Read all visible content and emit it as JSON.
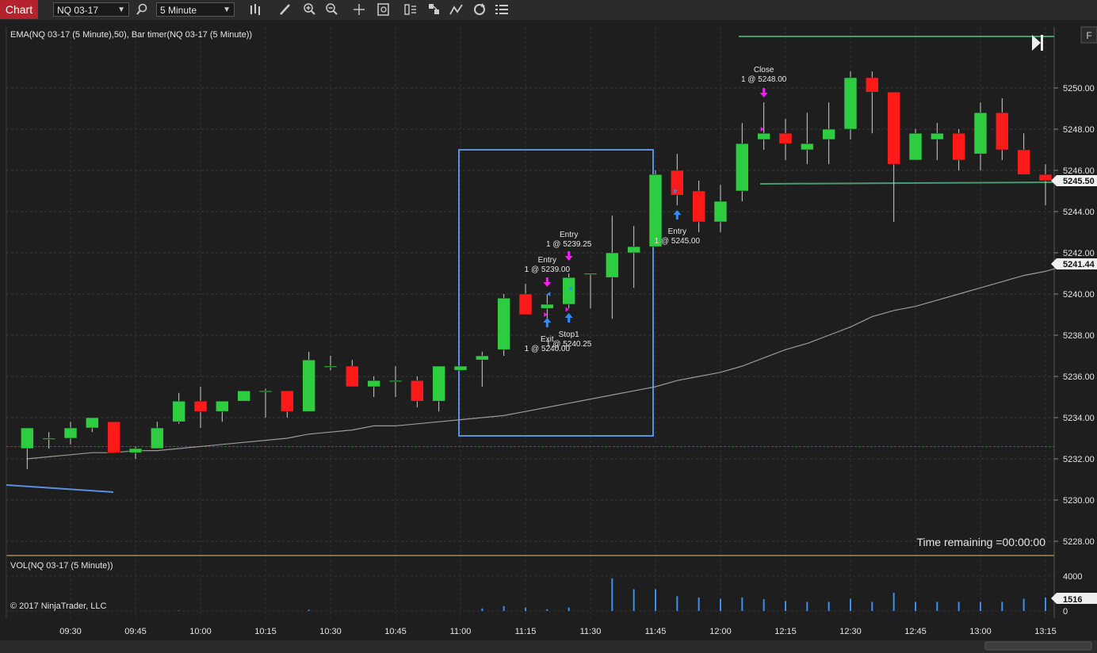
{
  "toolbar": {
    "chart_tab_label": "Chart",
    "instrument": "NQ 03-17",
    "interval": "5 Minute",
    "icons": [
      "search-icon",
      "bar-type-icon",
      "draw-pencil-icon",
      "zoom-in-icon",
      "zoom-out-icon",
      "crosshair-icon",
      "data-box-icon",
      "chart-trader-icon",
      "strategies-icon",
      "indicators-icon",
      "reload-icon",
      "properties-icon"
    ]
  },
  "price_panel": {
    "indicator_label": "EMA(NQ 03-17 (5 Minute),50), Bar timer(NQ 03-17 (5 Minute))",
    "time_remaining": "Time remaining =00:00:00",
    "panel_button": "F",
    "current_price_label": "5245.50",
    "ema_price_label": "5241.44",
    "colors": {
      "up": "#2ecc40",
      "down": "#ff1a1a",
      "ema": "#9a9a9a",
      "drawing_box": "#5b8fe0",
      "horizontal_lines": "#4a9b6e",
      "dashed_line": "#c0252d"
    }
  },
  "volume_panel": {
    "label": "VOL(NQ 03-17 (5 Minute))",
    "copyright": "© 2017 NinjaTrader, LLC",
    "current_volume_label": "1516",
    "color": "#3d8ff0"
  },
  "chart_data": {
    "type": "candlestick",
    "instrument": "NQ 03-17",
    "interval": "5 Minute",
    "price_axis_ticks": [
      "5250.00",
      "5248.00",
      "5246.00",
      "5244.00",
      "5242.00",
      "5240.00",
      "5238.00",
      "5236.00",
      "5234.00",
      "5232.00",
      "5230.00",
      "5228.00"
    ],
    "ylim": [
      5227.5,
      5251.6
    ],
    "volume_axis_ticks": [
      "4000",
      "0"
    ],
    "time_axis_ticks": [
      "09:30",
      "09:45",
      "10:00",
      "10:15",
      "10:30",
      "10:45",
      "11:00",
      "11:15",
      "11:30",
      "11:45",
      "12:00",
      "12:15",
      "12:30",
      "12:45",
      "13:00",
      "13:15"
    ],
    "bars": [
      {
        "time": "09:20",
        "o": 5232.5,
        "h": 5233.0,
        "l": 5231.5,
        "c": 5233.5
      },
      {
        "time": "09:25",
        "o": 5233.0,
        "h": 5233.3,
        "l": 5232.5,
        "c": 5233.0
      },
      {
        "time": "09:30",
        "o": 5233.0,
        "h": 5233.8,
        "l": 5232.7,
        "c": 5233.5
      },
      {
        "time": "09:35",
        "o": 5233.5,
        "h": 5234.0,
        "l": 5233.3,
        "c": 5234.0
      },
      {
        "time": "09:40",
        "o": 5233.8,
        "h": 5233.8,
        "l": 5232.3,
        "c": 5232.3
      },
      {
        "time": "09:45",
        "o": 5232.3,
        "h": 5232.6,
        "l": 5232.0,
        "c": 5232.5
      },
      {
        "time": "09:50",
        "o": 5232.5,
        "h": 5233.8,
        "l": 5232.5,
        "c": 5233.5
      },
      {
        "time": "09:55",
        "o": 5233.8,
        "h": 5235.2,
        "l": 5233.7,
        "c": 5234.8
      },
      {
        "time": "10:00",
        "o": 5234.8,
        "h": 5235.5,
        "l": 5233.5,
        "c": 5234.3
      },
      {
        "time": "10:05",
        "o": 5234.3,
        "h": 5234.8,
        "l": 5233.8,
        "c": 5234.8
      },
      {
        "time": "10:10",
        "o": 5234.8,
        "h": 5235.3,
        "l": 5234.8,
        "c": 5235.3
      },
      {
        "time": "10:15",
        "o": 5235.3,
        "h": 5235.4,
        "l": 5234.0,
        "c": 5235.3
      },
      {
        "time": "10:20",
        "o": 5235.3,
        "h": 5235.3,
        "l": 5234.0,
        "c": 5234.3
      },
      {
        "time": "10:25",
        "o": 5234.3,
        "h": 5237.2,
        "l": 5234.3,
        "c": 5236.8
      },
      {
        "time": "10:30",
        "o": 5236.5,
        "h": 5237.0,
        "l": 5236.3,
        "c": 5236.5
      },
      {
        "time": "10:35",
        "o": 5236.5,
        "h": 5236.8,
        "l": 5235.5,
        "c": 5235.5
      },
      {
        "time": "10:40",
        "o": 5235.5,
        "h": 5236.0,
        "l": 5235.0,
        "c": 5235.8
      },
      {
        "time": "10:45",
        "o": 5235.8,
        "h": 5236.5,
        "l": 5235.0,
        "c": 5235.8
      },
      {
        "time": "10:50",
        "o": 5235.8,
        "h": 5236.0,
        "l": 5234.5,
        "c": 5234.8
      },
      {
        "time": "10:55",
        "o": 5234.8,
        "h": 5236.5,
        "l": 5234.3,
        "c": 5236.5
      },
      {
        "time": "11:00",
        "o": 5236.3,
        "h": 5236.5,
        "l": 5236.3,
        "c": 5236.5
      },
      {
        "time": "11:05",
        "o": 5236.8,
        "h": 5237.2,
        "l": 5235.5,
        "c": 5237.0
      },
      {
        "time": "11:10",
        "o": 5237.3,
        "h": 5240.0,
        "l": 5237.0,
        "c": 5239.8
      },
      {
        "time": "11:15",
        "o": 5240.0,
        "h": 5240.5,
        "l": 5239.0,
        "c": 5239.0
      },
      {
        "time": "11:20",
        "o": 5239.3,
        "h": 5240.0,
        "l": 5238.8,
        "c": 5239.5
      },
      {
        "time": "11:25",
        "o": 5239.5,
        "h": 5241.0,
        "l": 5239.3,
        "c": 5240.8
      },
      {
        "time": "11:30",
        "o": 5241.0,
        "h": 5241.0,
        "l": 5239.3,
        "c": 5241.0
      },
      {
        "time": "11:35",
        "o": 5240.8,
        "h": 5243.8,
        "l": 5238.8,
        "c": 5242.0
      },
      {
        "time": "11:40",
        "o": 5242.0,
        "h": 5243.3,
        "l": 5240.3,
        "c": 5242.3
      },
      {
        "time": "11:45",
        "o": 5242.3,
        "h": 5246.0,
        "l": 5242.3,
        "c": 5245.8
      },
      {
        "time": "11:50",
        "o": 5246.0,
        "h": 5246.8,
        "l": 5244.3,
        "c": 5244.8
      },
      {
        "time": "11:55",
        "o": 5245.0,
        "h": 5245.5,
        "l": 5243.0,
        "c": 5243.5
      },
      {
        "time": "12:00",
        "o": 5243.5,
        "h": 5245.3,
        "l": 5243.0,
        "c": 5244.5
      },
      {
        "time": "12:05",
        "o": 5245.0,
        "h": 5248.3,
        "l": 5244.5,
        "c": 5247.3
      },
      {
        "time": "12:10",
        "o": 5247.5,
        "h": 5249.3,
        "l": 5247.0,
        "c": 5247.8
      },
      {
        "time": "12:15",
        "o": 5247.8,
        "h": 5248.5,
        "l": 5246.5,
        "c": 5247.3
      },
      {
        "time": "12:20",
        "o": 5247.0,
        "h": 5248.8,
        "l": 5246.3,
        "c": 5247.3
      },
      {
        "time": "12:25",
        "o": 5247.5,
        "h": 5249.3,
        "l": 5246.3,
        "c": 5248.0
      },
      {
        "time": "12:30",
        "o": 5248.0,
        "h": 5250.8,
        "l": 5247.5,
        "c": 5250.5
      },
      {
        "time": "12:35",
        "o": 5250.5,
        "h": 5250.8,
        "l": 5247.8,
        "c": 5249.8
      },
      {
        "time": "12:40",
        "o": 5249.8,
        "h": 5249.8,
        "l": 5243.5,
        "c": 5246.3
      },
      {
        "time": "12:45",
        "o": 5246.5,
        "h": 5248.0,
        "l": 5246.5,
        "c": 5247.8
      },
      {
        "time": "12:50",
        "o": 5247.5,
        "h": 5248.3,
        "l": 5246.5,
        "c": 5247.8
      },
      {
        "time": "12:55",
        "o": 5247.8,
        "h": 5248.0,
        "l": 5246.0,
        "c": 5246.5
      },
      {
        "time": "13:00",
        "o": 5246.8,
        "h": 5249.3,
        "l": 5246.0,
        "c": 5248.8
      },
      {
        "time": "13:05",
        "o": 5248.8,
        "h": 5249.5,
        "l": 5246.5,
        "c": 5247.0
      },
      {
        "time": "13:10",
        "o": 5247.0,
        "h": 5247.8,
        "l": 5245.8,
        "c": 5245.8
      },
      {
        "time": "13:15",
        "o": 5245.8,
        "h": 5246.3,
        "l": 5244.3,
        "c": 5245.5
      }
    ],
    "volume": [
      0,
      0,
      0,
      0,
      0,
      0,
      0,
      50,
      0,
      0,
      0,
      0,
      0,
      150,
      0,
      0,
      0,
      0,
      0,
      0,
      0,
      300,
      550,
      400,
      200,
      400,
      0,
      3750,
      2500,
      2500,
      1700,
      1550,
      1400,
      1550,
      1350,
      1150,
      1050,
      1050,
      1400,
      1050,
      2100,
      1050,
      1050,
      1050,
      1050,
      1050,
      1400,
      1550
    ],
    "ema": [
      5232.0,
      5232.1,
      5232.2,
      5232.3,
      5232.3,
      5232.4,
      5232.4,
      5232.5,
      5232.6,
      5232.7,
      5232.8,
      5232.9,
      5233.0,
      5233.2,
      5233.3,
      5233.4,
      5233.6,
      5233.6,
      5233.7,
      5233.8,
      5233.9,
      5234.0,
      5234.1,
      5234.3,
      5234.5,
      5234.7,
      5234.9,
      5235.1,
      5235.3,
      5235.5,
      5235.8,
      5236.0,
      5236.2,
      5236.5,
      5236.9,
      5237.3,
      5237.6,
      5238.0,
      5238.4,
      5238.9,
      5239.2,
      5239.4,
      5239.7,
      5240.0,
      5240.3,
      5240.6,
      5240.9,
      5241.1,
      5241.4
    ],
    "trade_markers": [
      {
        "label": "Entry",
        "detail": "1 @ 5239.00",
        "time": "11:20",
        "side": "sell"
      },
      {
        "label": "Exit",
        "detail": "1 @ 5240.00",
        "time": "11:20",
        "side": "buy"
      },
      {
        "label": "Entry",
        "detail": "1 @ 5239.25",
        "time": "11:25",
        "side": "sell"
      },
      {
        "label": "Stop1",
        "detail": "1 @ 5240.25",
        "time": "11:25",
        "side": "buy"
      },
      {
        "label": "Entry",
        "detail": "1 @ 5245.00",
        "time": "11:50",
        "side": "buy"
      },
      {
        "label": "Close",
        "detail": "1 @ 5248.00",
        "time": "12:10",
        "side": "sell"
      }
    ]
  }
}
